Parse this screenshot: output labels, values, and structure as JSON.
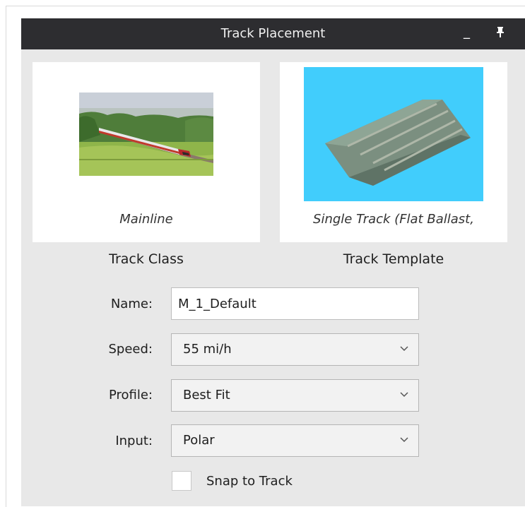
{
  "window": {
    "title": "Track Placement",
    "minimize_glyph": "_",
    "pin_icon": "pin-icon"
  },
  "track_class": {
    "caption": "Mainline",
    "label": "Track Class"
  },
  "track_template": {
    "caption": "Single Track (Flat Ballast,",
    "label": "Track Template",
    "sky_color": "#41cdfc"
  },
  "form": {
    "name_label": "Name:",
    "name_value": "M_1_Default",
    "speed_label": "Speed:",
    "speed_value": "55 mi/h",
    "profile_label": "Profile:",
    "profile_value": "Best Fit",
    "input_label": "Input:",
    "input_value": "Polar",
    "snap_label": "Snap to Track",
    "snap_checked": false
  }
}
